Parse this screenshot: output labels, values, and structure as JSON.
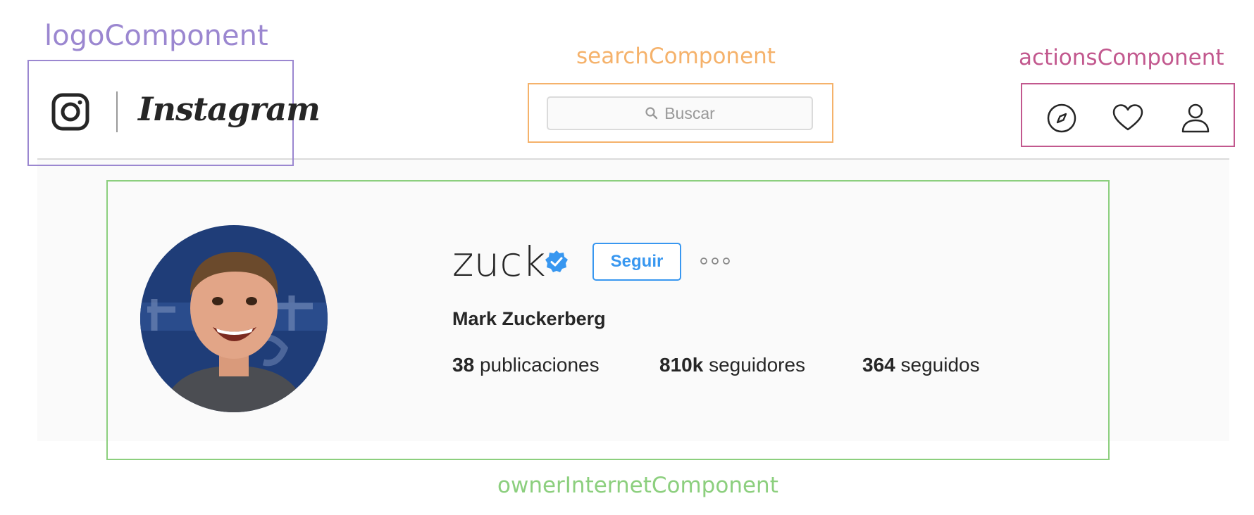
{
  "labels": {
    "logo": "logoComponent",
    "search": "searchComponent",
    "actions": "actionsComponent",
    "owner": "ownerInternetComponent"
  },
  "colors": {
    "logo": "#9b87d0",
    "search": "#f5b26b",
    "actions": "#c2588e",
    "owner": "#8ccf7e",
    "instagram_blue": "#3897f0"
  },
  "header": {
    "logo_icon": "instagram-camera-icon",
    "wordmark": "Instagram",
    "search": {
      "placeholder": "Buscar",
      "icon": "search-icon"
    },
    "actions": [
      {
        "icon": "compass-icon"
      },
      {
        "icon": "heart-icon"
      },
      {
        "icon": "user-icon"
      }
    ]
  },
  "profile": {
    "username": "zuck",
    "verified_icon": "verified-badge-icon",
    "follow_label": "Seguir",
    "more_icon": "more-options-icon",
    "full_name": "Mark Zuckerberg",
    "stats": {
      "posts_count": "38",
      "posts_label": "publicaciones",
      "followers_count": "810k",
      "followers_label": "seguidores",
      "following_count": "364",
      "following_label": "seguidos"
    }
  }
}
